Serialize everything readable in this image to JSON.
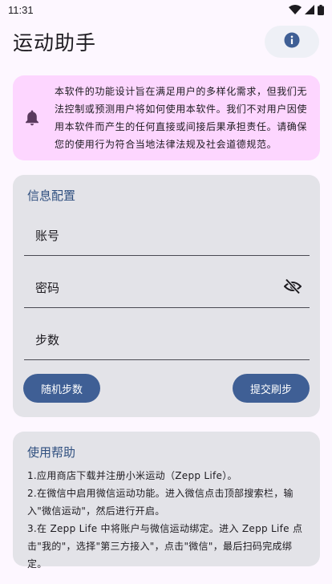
{
  "status_bar": {
    "time": "11:31"
  },
  "app_bar": {
    "title": "运动助手"
  },
  "notice": {
    "text": "本软件的功能设计旨在满足用户的多样化需求，但我们无法控制或预测用户将如何使用本软件。我们不对用户因使用本软件而产生的任何直接或间接后果承担责任。请确保您的使用行为符合当地法律法规及社会道德规范。"
  },
  "config": {
    "title": "信息配置",
    "account_label": "账号",
    "password_label": "密码",
    "steps_label": "步数",
    "random_button": "随机步数",
    "submit_button": "提交刷步"
  },
  "help": {
    "title": "使用帮助",
    "lines": [
      "1.应用商店下载并注册小米运动（Zepp Life）。",
      "2.在微信中启用微信运动功能。进入微信点击顶部搜索栏，输入\"微信运动\"，然后进行开启。",
      "3.在 Zepp Life 中将账户与微信运动绑定。进入 Zepp Life 点击\"我的\"，选择\"第三方接入\"，点击\"微信\"，最后扫码完成绑定。"
    ]
  },
  "colors": {
    "background": "#fdf7ff",
    "notice_bg": "#fdd6ff",
    "card_bg": "#e3e3e8",
    "primary": "#3f5f95",
    "section_title": "#2f4f7f"
  },
  "icons": {
    "status": [
      "wifi-icon",
      "signal-icon",
      "battery-icon"
    ],
    "info": "info-icon",
    "notice": "bell-icon",
    "password_toggle": "eye-off-icon"
  }
}
